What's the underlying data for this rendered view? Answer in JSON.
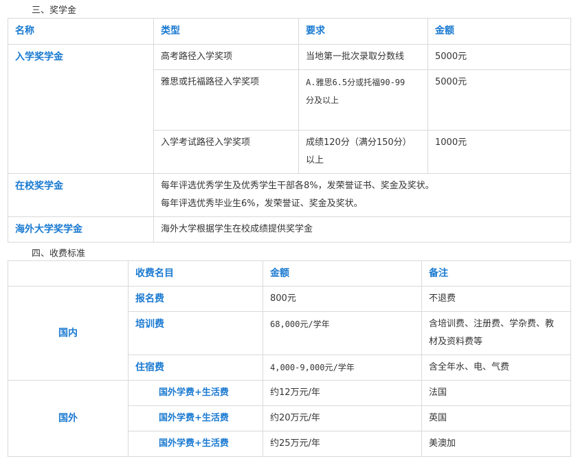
{
  "section3": {
    "title": "三、奖学金",
    "headers": [
      "名称",
      "类型",
      "要求",
      "金额"
    ],
    "entrance": {
      "name": "入学奖学金",
      "rows": [
        {
          "type": "高考路径入学奖项",
          "req": "当地第一批次录取分数线",
          "amount": "5000元"
        },
        {
          "type": "雅思或托福路径入学奖项",
          "req_line1": "A.雅思6.5分或托福90-99",
          "req_line2": "分及以上",
          "amount": "5000元"
        },
        {
          "type": "入学考试路径入学奖项",
          "req_line1": "成绩120分（满分150分）",
          "req_line2": "以上",
          "amount": "1000元"
        }
      ]
    },
    "oncampus": {
      "name": "在校奖学金",
      "line1": "每年评选优秀学生及优秀学生干部各8%，发荣誉证书、奖金及奖状。",
      "line2": "每年评选优秀毕业生6%，发荣誉证、奖金及奖状。"
    },
    "overseas": {
      "name": "海外大学奖学金",
      "desc": "海外大学根据学生在校成绩提供奖学金"
    }
  },
  "section4": {
    "title": "四、收费标准",
    "headers": [
      "收费名目",
      "金额",
      "备注"
    ],
    "domestic": {
      "label": "国内",
      "rows": [
        {
          "item": "报名费",
          "amount": "800元",
          "note": "不退费"
        },
        {
          "item": "培训费",
          "amount": "68,000元/学年",
          "note_line1": "含培训费、注册费、学杂费、教",
          "note_line2": "材及资料费等"
        },
        {
          "item": "住宿费",
          "amount": "4,000-9,000元/学年",
          "note": "含全年水、电、气费"
        }
      ]
    },
    "abroad": {
      "label": "国外",
      "rows": [
        {
          "item": "国外学费+生活费",
          "amount": "约12万元/年",
          "note": "法国"
        },
        {
          "item": "国外学费+生活费",
          "amount": "约20万元/年",
          "note": "英国"
        },
        {
          "item": "国外学费+生活费",
          "amount": "约25万元/年",
          "note": "美澳加"
        }
      ]
    }
  }
}
